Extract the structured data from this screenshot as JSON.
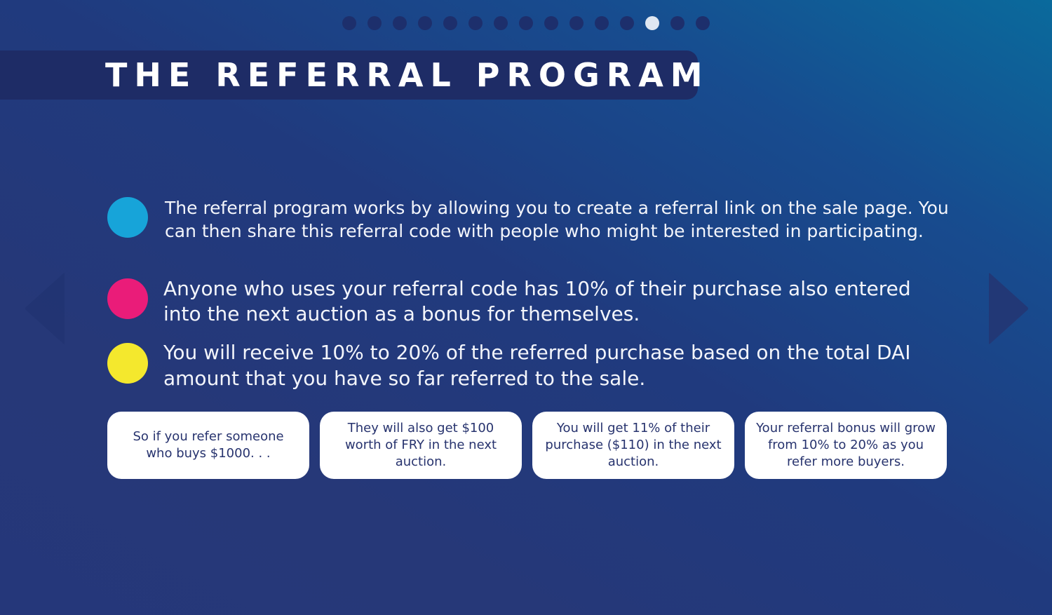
{
  "pagination": {
    "total": 15,
    "active_index": 12
  },
  "title": "THE REFERRAL PROGRAM",
  "nav": {
    "prev_icon": "chevron-left-icon",
    "next_icon": "chevron-right-icon"
  },
  "bullets": [
    {
      "color": "#17a4d9",
      "text": "The referral program works by allowing you to create a referral link on the sale page. You can then share this referral code with people who might be interested in participating."
    },
    {
      "color": "#ea1c79",
      "text": "Anyone who uses your referral code has 10% of their purchase also entered into the next auction as a bonus for themselves."
    },
    {
      "color": "#f4e82d",
      "text": "You will receive 10% to 20% of the referred purchase based on the total DAI amount that you have so far referred to the sale."
    }
  ],
  "cards": [
    {
      "text": "So if you refer someone who buys $1000. . ."
    },
    {
      "text": "They will also get $100 worth of FRY in the next auction."
    },
    {
      "text": "You will get 11% of their purchase ($110) in the next auction."
    },
    {
      "text": "Your referral bonus will grow from 10% to 20% as you refer more buyers."
    }
  ]
}
